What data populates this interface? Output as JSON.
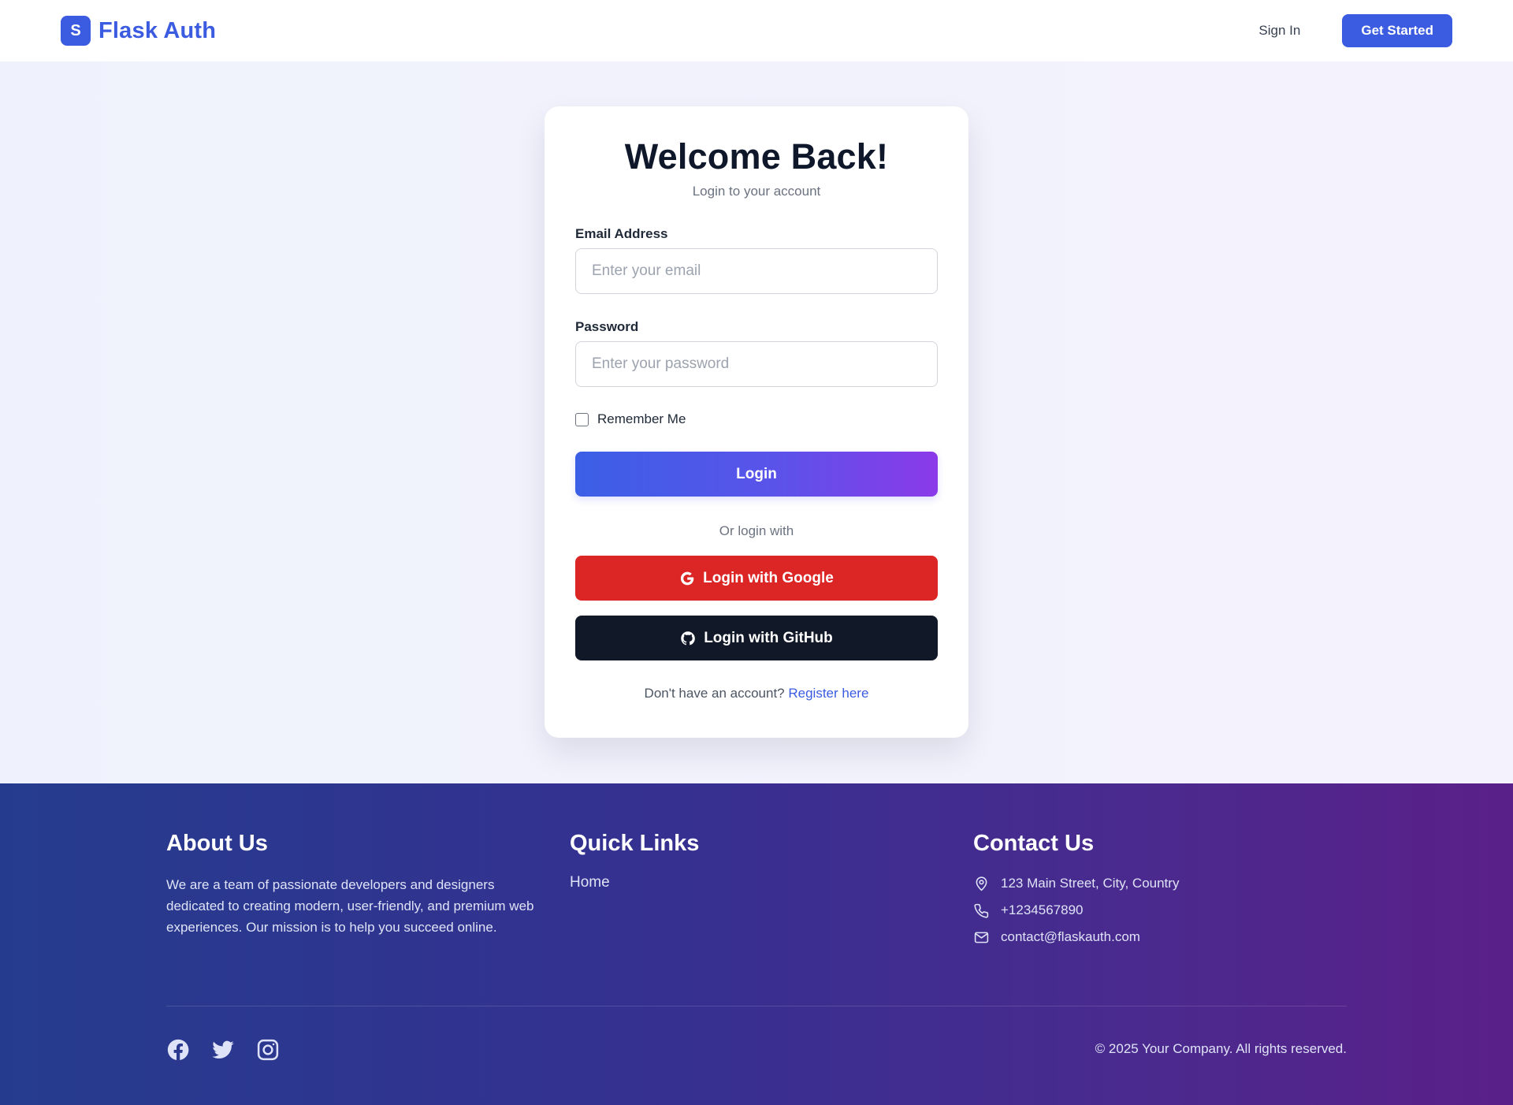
{
  "header": {
    "brand_badge": "S",
    "brand_name": "Flask Auth",
    "signin_label": "Sign In",
    "cta_label": "Get Started"
  },
  "login": {
    "title": "Welcome Back!",
    "subtitle": "Login to your account",
    "email_label": "Email Address",
    "email_placeholder": "Enter your email",
    "password_label": "Password",
    "password_placeholder": "Enter your password",
    "remember_label": "Remember Me",
    "login_button": "Login",
    "divider_text": "Or login with",
    "google_button": "Login with Google",
    "github_button": "Login with GitHub",
    "register_prompt": "Don't have an account?",
    "register_link": "Register here"
  },
  "footer": {
    "about_heading": "About Us",
    "about_text": "We are a team of passionate developers and designers dedicated to creating modern, user-friendly, and premium web experiences. Our mission is to help you succeed online.",
    "links_heading": "Quick Links",
    "links": [
      "Home"
    ],
    "contact_heading": "Contact Us",
    "contact": {
      "address": "123 Main Street, City, Country",
      "phone": "+1234567890",
      "email": "contact@flaskauth.com"
    },
    "socials": [
      "facebook-icon",
      "twitter-icon",
      "instagram-icon"
    ],
    "copyright": "© 2025 Your Company. All rights reserved."
  },
  "colors": {
    "brand": "#3b5be0",
    "google": "#dc2626",
    "github": "#111827",
    "login_gradient_start": "#3b5fe6",
    "login_gradient_end": "#8b3ae8"
  }
}
